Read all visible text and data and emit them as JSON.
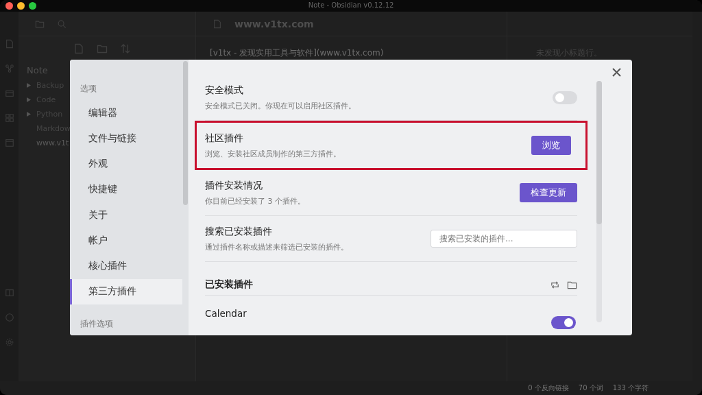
{
  "window": {
    "title": "Note - Obsidian v0.12.12"
  },
  "file_explorer": {
    "vault": "Note",
    "items": [
      {
        "name": "Backup",
        "kind": "folder",
        "selected": false
      },
      {
        "name": "Code",
        "kind": "folder",
        "selected": false
      },
      {
        "name": "Python",
        "kind": "folder",
        "selected": false
      },
      {
        "name": "Markdow",
        "kind": "file",
        "selected": false
      },
      {
        "name": "www.v1t",
        "kind": "file",
        "selected": true
      }
    ]
  },
  "editor": {
    "title": "www.v1tx.com",
    "text": "[v1tx - 发现实用工具与软件](www.v1tx.com)"
  },
  "outline": {
    "empty_text": "未发现小标题行。"
  },
  "status_bar": [
    "0 个反向链接",
    "70 个词",
    "133 个字符"
  ],
  "settings": {
    "sidebar": [
      {
        "heading": "选项",
        "items": [
          {
            "label": "编辑器",
            "selected": false
          },
          {
            "label": "文件与链接",
            "selected": false
          },
          {
            "label": "外观",
            "selected": false
          },
          {
            "label": "快捷键",
            "selected": false
          },
          {
            "label": "关于",
            "selected": false
          },
          {
            "label": "帐户",
            "selected": false
          },
          {
            "label": "核心插件",
            "selected": false
          },
          {
            "label": "第三方插件",
            "selected": true
          }
        ]
      },
      {
        "heading": "插件选项"
      }
    ],
    "rows": [
      {
        "kind": "toggle",
        "title": "安全模式",
        "description": "安全模式已关闭。你现在可以启用社区插件。",
        "on": false,
        "highlighted": false
      },
      {
        "kind": "button",
        "title": "社区插件",
        "description": "浏览、安装社区成员制作的第三方插件。",
        "button": "浏览",
        "highlighted": true
      },
      {
        "kind": "button",
        "title": "插件安装情况",
        "description": "你目前已经安装了 3 个插件。",
        "button": "检查更新",
        "highlighted": false
      },
      {
        "kind": "search",
        "title": "搜索已安装插件",
        "description": "通过插件名称或描述来筛选已安装的插件。",
        "placeholder": "搜索已安装的插件...",
        "highlighted": false
      }
    ],
    "installed_heading": "已安装插件",
    "plugins": [
      {
        "name": "Calendar",
        "on": true
      }
    ]
  }
}
